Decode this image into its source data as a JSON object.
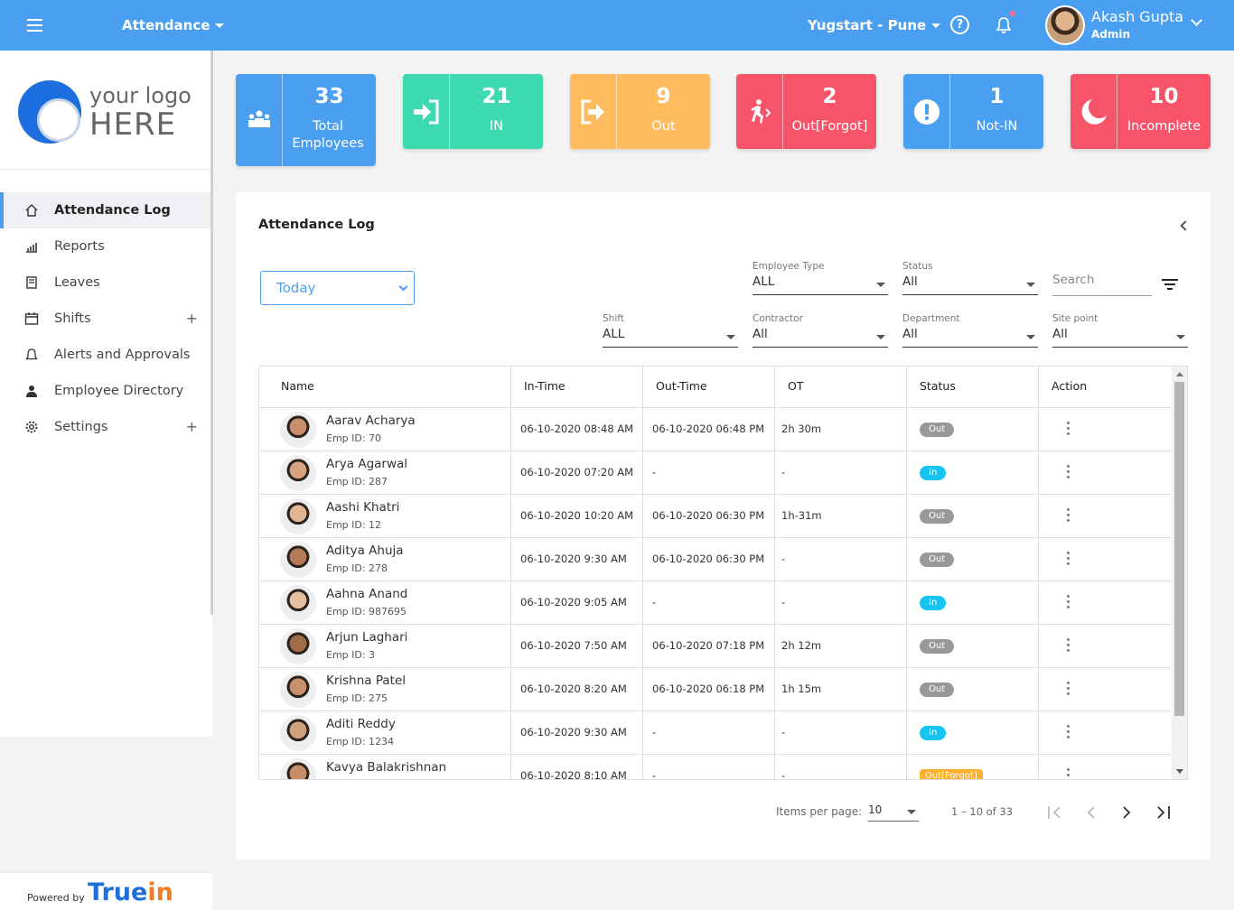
{
  "topbar": {
    "module": "Attendance",
    "site": "Yugstart - Pune",
    "user_name": "Akash Gupta",
    "user_role": "Admin",
    "icons": [
      "menu-icon",
      "help-icon",
      "bell-icon",
      "chevron-down-icon"
    ]
  },
  "sidebar": {
    "logo_line1": "your logo",
    "logo_line2": "HERE",
    "items": [
      {
        "label": "Attendance Log",
        "icon": "home-icon",
        "active": true
      },
      {
        "label": "Reports",
        "icon": "bar-chart-icon"
      },
      {
        "label": "Leaves",
        "icon": "calendar-icon"
      },
      {
        "label": "Shifts",
        "icon": "calendar-grid-icon",
        "expandable": true
      },
      {
        "label": "Alerts and Approvals",
        "icon": "bell-icon"
      },
      {
        "label": "Employee Directory",
        "icon": "person-icon"
      },
      {
        "label": "Settings",
        "icon": "gear-icon",
        "expandable": true
      }
    ],
    "powered_by": "Powered by",
    "brand_part1": "True",
    "brand_part2": "in"
  },
  "stats": [
    {
      "value": "33",
      "label": "Total Employees",
      "color": "#4a9ff0",
      "icon": "group-icon"
    },
    {
      "value": "21",
      "label": "IN",
      "color": "#3dd9b0",
      "icon": "sign-in-icon"
    },
    {
      "value": "9",
      "label": "Out",
      "color": "#ffbc5e",
      "icon": "sign-out-icon"
    },
    {
      "value": "2",
      "label": "Out[Forgot]",
      "color": "#f7546a",
      "icon": "running-person-icon"
    },
    {
      "value": "1",
      "label": "Not-IN",
      "color": "#4a9ff0",
      "icon": "alert-icon"
    },
    {
      "value": "10",
      "label": "Incomplete",
      "color": "#f7546a",
      "icon": "moon-icon"
    }
  ],
  "panel": {
    "title": "Attendance Log",
    "date_filter": "Today",
    "search_placeholder": "Search",
    "filters": {
      "employee_type": {
        "label": "Employee Type",
        "value": "ALL"
      },
      "status": {
        "label": "Status",
        "value": "All"
      },
      "shift": {
        "label": "Shift",
        "value": "ALL"
      },
      "contractor": {
        "label": "Contractor",
        "value": "All"
      },
      "department": {
        "label": "Department",
        "value": "All"
      },
      "site_point": {
        "label": "Site point",
        "value": "All"
      }
    }
  },
  "table": {
    "headers": [
      "Name",
      "In-Time",
      "Out-Time",
      "OT",
      "Status",
      "Action"
    ],
    "rows": [
      {
        "name": "Aarav Acharya",
        "emp_id": "Emp ID: 70",
        "in": "06-10-2020 08:48 AM",
        "out": "06-10-2020 06:48 PM",
        "ot": "2h 30m",
        "status": "Out"
      },
      {
        "name": "Arya Agarwal",
        "emp_id": "Emp ID: 287",
        "in": "06-10-2020 07:20 AM",
        "out": "-",
        "ot": "-",
        "status": "In"
      },
      {
        "name": "Aashi Khatri",
        "emp_id": "Emp ID: 12",
        "in": "06-10-2020 10:20 AM",
        "out": "06-10-2020 06:30 PM",
        "ot": "1h-31m",
        "status": "Out"
      },
      {
        "name": "Aditya  Ahuja",
        "emp_id": "Emp ID: 278",
        "in": "06-10-2020 9:30 AM",
        "out": "06-10-2020 06:30 PM",
        "ot": "-",
        "status": "Out"
      },
      {
        "name": "Aahna Anand",
        "emp_id": "Emp ID: 987695",
        "in": "06-10-2020 9:05 AM",
        "out": "-",
        "ot": "-",
        "status": "In"
      },
      {
        "name": "Arjun Laghari",
        "emp_id": "Emp ID: 3",
        "in": "06-10-2020 7:50 AM",
        "out": "06-10-2020 07:18 PM",
        "ot": "2h 12m",
        "status": "Out"
      },
      {
        "name": "Krishna Patel",
        "emp_id": "Emp ID: 275",
        "in": "06-10-2020 8:20 AM",
        "out": "06-10-2020 06:18 PM",
        "ot": "1h 15m",
        "status": "Out"
      },
      {
        "name": "Aditi Reddy",
        "emp_id": "Emp ID: 1234",
        "in": "06-10-2020 9:30 AM",
        "out": "-",
        "ot": "-",
        "status": "In"
      },
      {
        "name": "Kavya Balakrishnan",
        "emp_id": "",
        "in": "06-10-2020 8:10 AM",
        "out": "-",
        "ot": "-",
        "status": "Out[Forgot]"
      }
    ]
  },
  "pagination": {
    "items_label": "Items per page:",
    "items_value": "10",
    "range": "1 – 10 of 33"
  }
}
